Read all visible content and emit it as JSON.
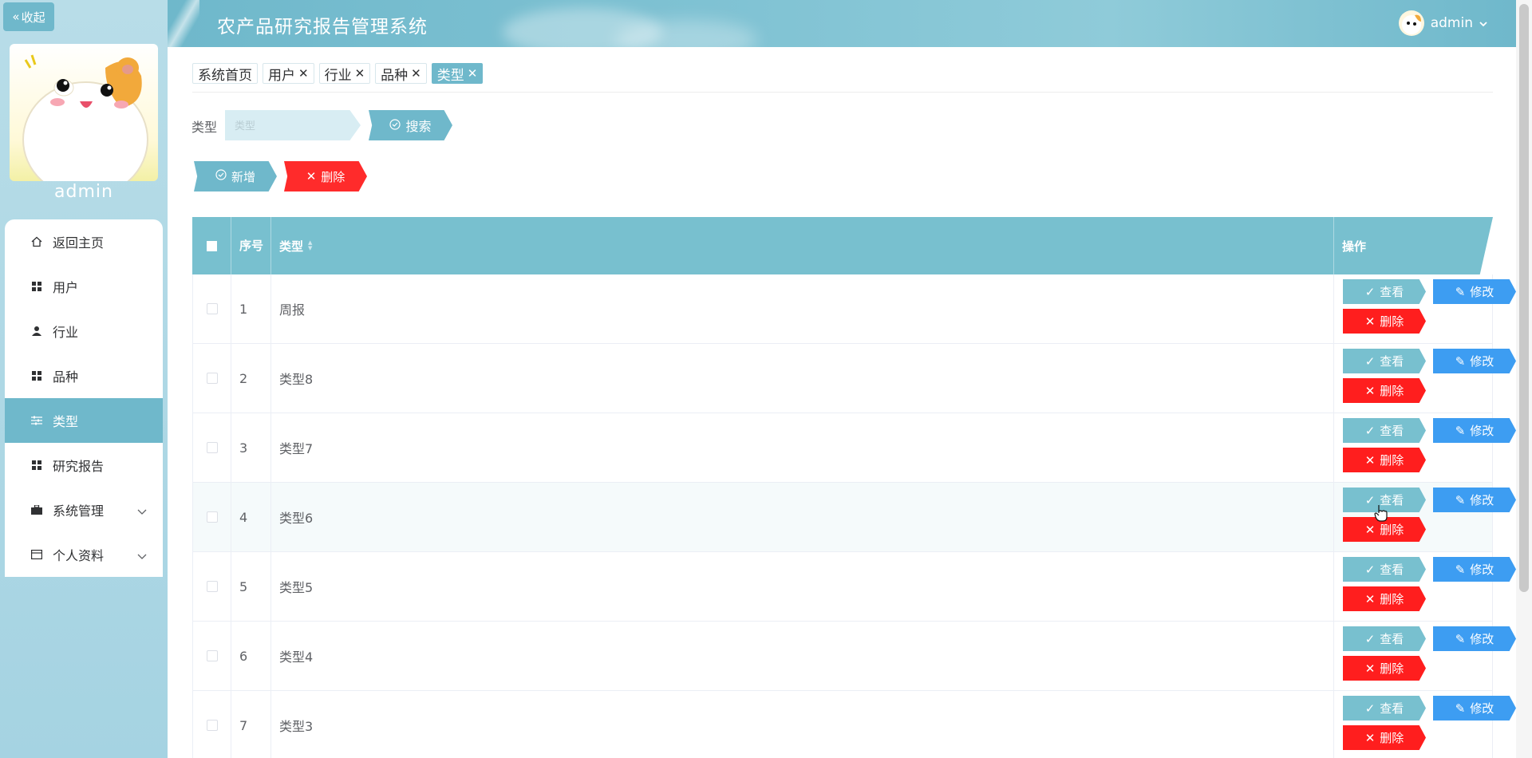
{
  "sidebar": {
    "collapse_label": "收起",
    "username": "admin",
    "items": [
      {
        "label": "返回主页",
        "icon": "home-icon"
      },
      {
        "label": "用户",
        "icon": "grid-icon"
      },
      {
        "label": "行业",
        "icon": "person-icon"
      },
      {
        "label": "品种",
        "icon": "grid-icon"
      },
      {
        "label": "类型",
        "icon": "sliders-icon",
        "active": true
      },
      {
        "label": "研究报告",
        "icon": "grid-icon"
      },
      {
        "label": "系统管理",
        "icon": "briefcase-icon",
        "expandable": true
      },
      {
        "label": "个人资料",
        "icon": "wallet-icon",
        "expandable": true
      }
    ]
  },
  "header": {
    "title": "农产品研究报告管理系统",
    "user": "admin"
  },
  "tabs": [
    {
      "label": "系统首页",
      "closable": false
    },
    {
      "label": "用户",
      "closable": true
    },
    {
      "label": "行业",
      "closable": true
    },
    {
      "label": "品种",
      "closable": true
    },
    {
      "label": "类型",
      "closable": true,
      "active": true
    }
  ],
  "search": {
    "label": "类型",
    "placeholder": "类型",
    "value": "",
    "button": "搜索"
  },
  "toolbar": {
    "add_label": "新增",
    "delete_label": "删除"
  },
  "table": {
    "columns": {
      "seq": "序号",
      "type": "类型",
      "ops": "操作"
    },
    "actions": {
      "view": "查看",
      "edit": "修改",
      "delete": "删除"
    },
    "rows": [
      {
        "seq": "1",
        "type": "周报"
      },
      {
        "seq": "2",
        "type": "类型8"
      },
      {
        "seq": "3",
        "type": "类型7"
      },
      {
        "seq": "4",
        "type": "类型6"
      },
      {
        "seq": "5",
        "type": "类型5"
      },
      {
        "seq": "6",
        "type": "类型4"
      },
      {
        "seq": "7",
        "type": "类型3"
      }
    ]
  },
  "colors": {
    "accent": "#6fb8cb",
    "table_header": "#78c0cf",
    "edit_blue": "#3d9df2",
    "danger_red": "#ff1e1e"
  }
}
